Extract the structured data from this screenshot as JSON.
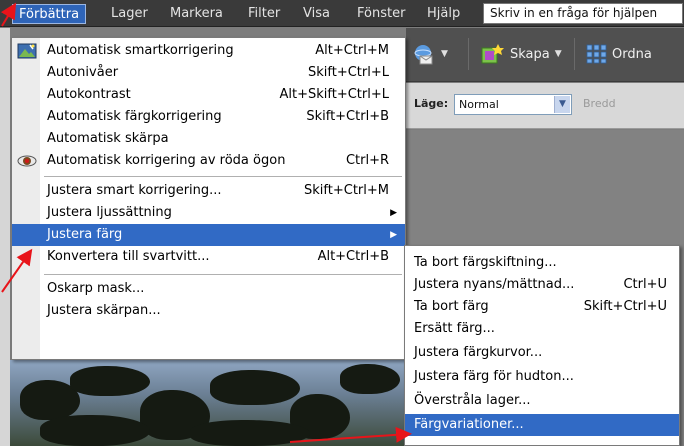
{
  "menubar": {
    "items": [
      "Förbättra",
      "Lager",
      "Markera",
      "Filter",
      "Visa",
      "Fönster",
      "Hjälp"
    ],
    "help_box": "Skriv in en fråga för hjälpen"
  },
  "toolbar": {
    "create_label": "Skapa",
    "organize_label": "Ordna"
  },
  "options": {
    "mode_label": "Läge:",
    "mode_value": "Normal",
    "width_label": "Bredd"
  },
  "menu": {
    "items": [
      {
        "label": "Automatisk smartkorrigering",
        "shortcut": "Alt+Ctrl+M"
      },
      {
        "label": "Autonivåer",
        "shortcut": "Skift+Ctrl+L"
      },
      {
        "label": "Autokontrast",
        "shortcut": "Alt+Skift+Ctrl+L"
      },
      {
        "label": "Automatisk färgkorrigering",
        "shortcut": "Skift+Ctrl+B"
      },
      {
        "label": "Automatisk skärpa",
        "shortcut": ""
      },
      {
        "label": "Automatisk korrigering av röda ögon",
        "shortcut": "Ctrl+R"
      },
      {
        "label": "Justera smart korrigering...",
        "shortcut": "Skift+Ctrl+M"
      },
      {
        "label": "Justera ljussättning",
        "shortcut": ""
      },
      {
        "label": "Justera färg",
        "shortcut": ""
      },
      {
        "label": "Konvertera till svartvitt...",
        "shortcut": "Alt+Ctrl+B"
      },
      {
        "label": "Oskarp mask...",
        "shortcut": ""
      },
      {
        "label": "Justera skärpan...",
        "shortcut": ""
      }
    ]
  },
  "submenu": {
    "items": [
      {
        "label": "Ta bort färgskiftning...",
        "shortcut": ""
      },
      {
        "label": "Justera nyans/mättnad...",
        "shortcut": "Ctrl+U"
      },
      {
        "label": "Ta bort färg",
        "shortcut": "Skift+Ctrl+U"
      },
      {
        "label": "Ersätt färg...",
        "shortcut": ""
      },
      {
        "label": "Justera färgkurvor...",
        "shortcut": ""
      },
      {
        "label": "Justera färg för hudton...",
        "shortcut": ""
      },
      {
        "label": "Överstråla lager...",
        "shortcut": ""
      },
      {
        "label": "Färgvariationer...",
        "shortcut": ""
      }
    ]
  },
  "colors": {
    "highlight": "#316ac5",
    "annotation_arrow": "#e8141a"
  },
  "icons": [
    "smart-fix-icon",
    "red-eye-icon",
    "share-icon",
    "create-icon",
    "organize-icon",
    "submenu-arrow-icon"
  ]
}
